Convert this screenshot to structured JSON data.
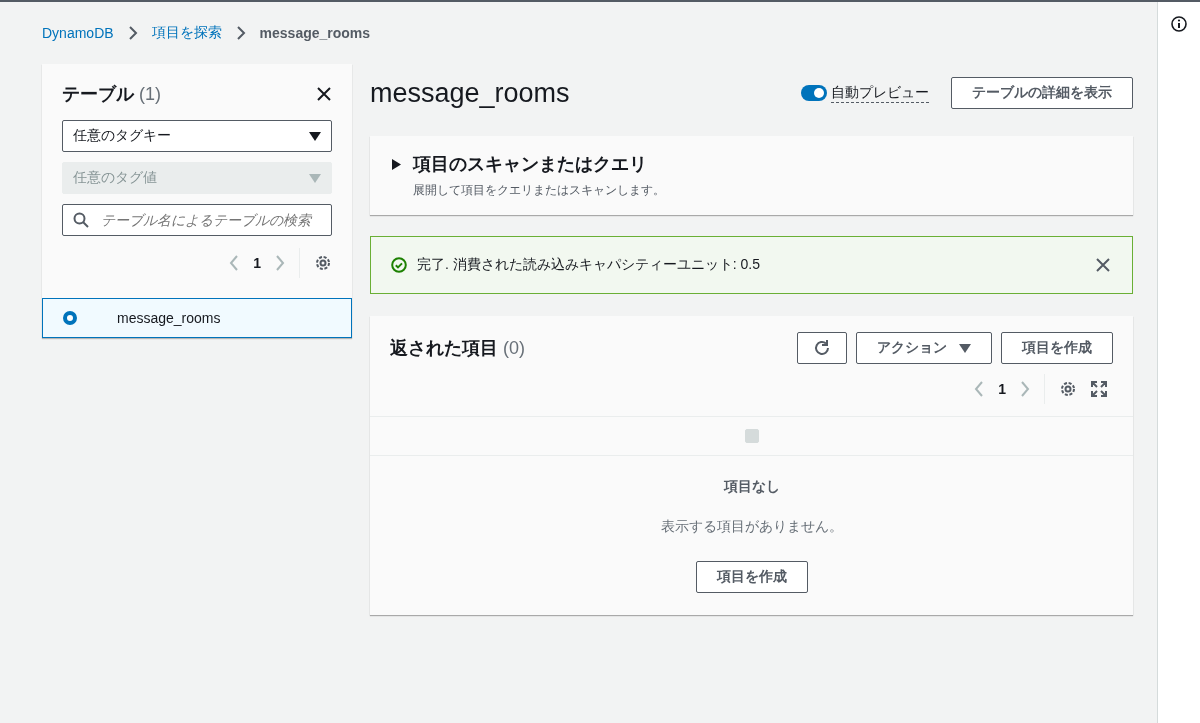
{
  "breadcrumbs": [
    {
      "label": "DynamoDB",
      "link": true
    },
    {
      "label": "項目を探索",
      "link": true
    },
    {
      "label": "message_rooms",
      "link": false
    }
  ],
  "sidebar": {
    "title": "テーブル",
    "count": "(1)",
    "tag_key_select": {
      "value": "任意のタグキー"
    },
    "tag_value_select": {
      "placeholder": "任意のタグ値",
      "disabled": true
    },
    "search": {
      "placeholder": "テーブル名によるテーブルの検索"
    },
    "page": "1",
    "tables": [
      {
        "name": "message_rooms",
        "selected": true
      }
    ]
  },
  "main": {
    "title": "message_rooms",
    "auto_preview": {
      "label": "自動プレビュー",
      "on": true
    },
    "details_button": "テーブルの詳細を表示",
    "scan_panel": {
      "title": "項目のスキャンまたはクエリ",
      "description": "展開して項目をクエリまたはスキャンします。",
      "expanded": false
    },
    "alert": {
      "message": "完了. 消費された読み込みキャパシティーユニット: 0.5"
    },
    "items_panel": {
      "title": "返された項目",
      "count": "(0)",
      "actions_button": "アクション",
      "create_button": "項目を作成",
      "page": "1",
      "select_all": {
        "checked": false,
        "disabled": true
      },
      "empty_title": "項目なし",
      "empty_message": "表示する項目がありません。",
      "empty_create_button": "項目を作成"
    }
  }
}
